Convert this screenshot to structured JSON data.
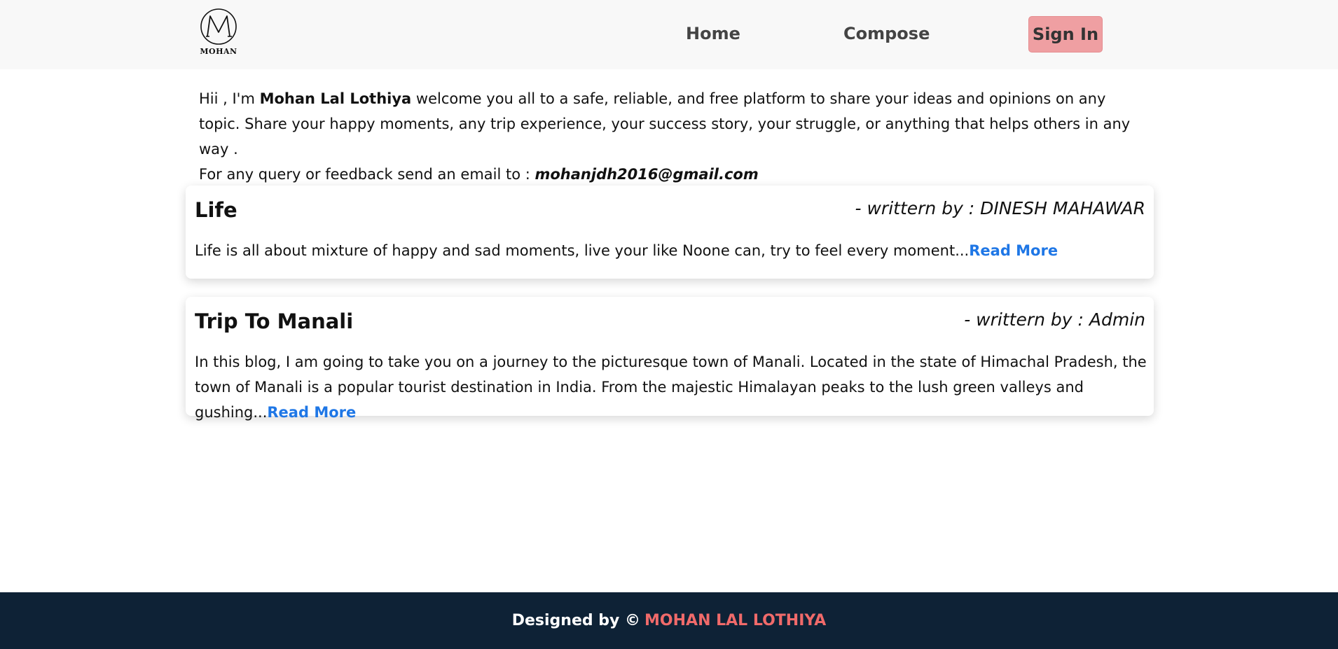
{
  "header": {
    "logo_text": "MOHAN",
    "nav": {
      "home": "Home",
      "compose": "Compose",
      "signin": "Sign In"
    }
  },
  "intro": {
    "greeting": "Hii , I'm ",
    "name": "Mohan Lal Lothiya",
    "message": " welcome you all to a safe, reliable, and free platform to share your ideas and opinions on any topic. Share your happy moments, any trip experience, your success story, your struggle, or anything that helps others in any way .",
    "query_text": "For any query or feedback send an email to : ",
    "email": "mohanjdh2016@gmail.com"
  },
  "posts": [
    {
      "title": "Life",
      "author": "- writtern by : DINESH MAHAWAR",
      "excerpt": "Life is all about mixture of happy and sad moments, live your like Noone can, try to feel every moment...",
      "read_more": "Read More"
    },
    {
      "title": "Trip To Manali",
      "author": "- writtern by : Admin",
      "excerpt": "In this blog, I am going to take you on a journey to the picturesque town of Manali. Located in the state of Himachal Pradesh, the town of Manali is a popular tourist destination in India. From the majestic Himalayan peaks to the lush green valleys and gushing...",
      "read_more": "Read More"
    }
  ],
  "footer": {
    "designed_by": "Designed by ©",
    "designer_name": "MOHAN LAL LOTHIYA"
  },
  "colors": {
    "header_bg": "#f8f8f8",
    "signin_bg": "#ef9fa2",
    "link": "#1f77e6",
    "footer_bg": "#0e2236",
    "footer_accent": "#f06a6a"
  }
}
